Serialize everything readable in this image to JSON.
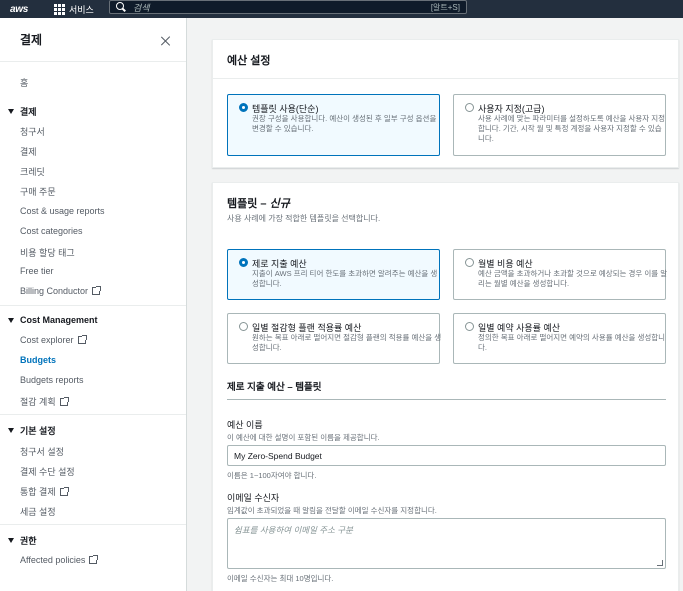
{
  "topnav": {
    "logo": "aws",
    "services_label": "서비스",
    "search_placeholder": "검색",
    "search_shortcut": "[알트+S]"
  },
  "sidebar": {
    "title": "결제",
    "home": "홈",
    "billing_section": {
      "label": "결제",
      "items": [
        "청구서",
        "결제",
        "크레딧",
        "구매 주문",
        "Cost & usage reports",
        "Cost categories",
        "비용 할당 태그",
        "Free tier",
        "Billing Conductor"
      ]
    },
    "cost_section": {
      "label": "Cost Management",
      "items": [
        "Cost explorer",
        "Budgets",
        "Budgets reports",
        "절감 계획"
      ]
    },
    "settings_section": {
      "label": "기본 설정",
      "items": [
        "청구서 설정",
        "결제 수단 설정",
        "통합 결제",
        "세금 설정"
      ]
    },
    "permissions_section": {
      "label": "권한",
      "items": [
        "Affected policies"
      ]
    }
  },
  "budget_setup": {
    "title": "예산 설정",
    "options": [
      {
        "label": "템플릿 사용(단순)",
        "desc": "권장 구성을 사용합니다. 예산이 생성된 후 일부 구성 옵션을 변경할 수 있습니다.",
        "selected": true
      },
      {
        "label": "사용자 지정(고급)",
        "desc": "사용 사례에 맞는 파라미터를 설정하도록 예산을 사용자 지정합니다. 기간, 시작 월 및 특정 계정을 사용자 지정할 수 있습니다.",
        "selected": false
      }
    ]
  },
  "template": {
    "title_prefix": "템플릿 – ",
    "title_new": "신규",
    "desc": "사용 사례에 가장 적합한 템플릿을 선택합니다.",
    "options": [
      {
        "label": "제로 지출 예산",
        "desc": "지출이 AWS 프리 티어 한도를 초과하면 알려주는 예산을 생성합니다.",
        "selected": true
      },
      {
        "label": "월별 비용 예산",
        "desc": "예산 금액을 초과하거나 초과할 것으로 예상되는 경우 이를 알리는 월별 예산을 생성합니다.",
        "selected": false
      },
      {
        "label": "일별 절감형 플랜 적용률 예산",
        "desc": "원하는 목표 아래로 떨어지면 절감형 플랜의 적용률 예산을 생성합니다.",
        "selected": false
      },
      {
        "label": "일별 예약 사용률 예산",
        "desc": "정의한 목표 아래로 떨어지면 예약의 사용률 예산을 생성합니다.",
        "selected": false
      }
    ],
    "section_title": "제로 지출 예산 – 템플릿",
    "budget_name": {
      "label": "예산 이름",
      "desc": "이 예산에 대한 설명이 포함된 이름을 제공합니다.",
      "value": "My Zero-Spend Budget",
      "hint": "이름은 1~100자여야 합니다."
    },
    "email": {
      "label": "이메일 수신자",
      "desc": "임계값이 초과되었을 때 알림을 전달할 이메일 수신자를 지정합니다.",
      "placeholder": "쉼표를 사용하여 이메일 주소 구분",
      "hint": "이메일 수신자는 최대 10명입니다."
    }
  },
  "colors": {
    "accent": "#0073bb",
    "nav_bg": "#232f3e"
  }
}
